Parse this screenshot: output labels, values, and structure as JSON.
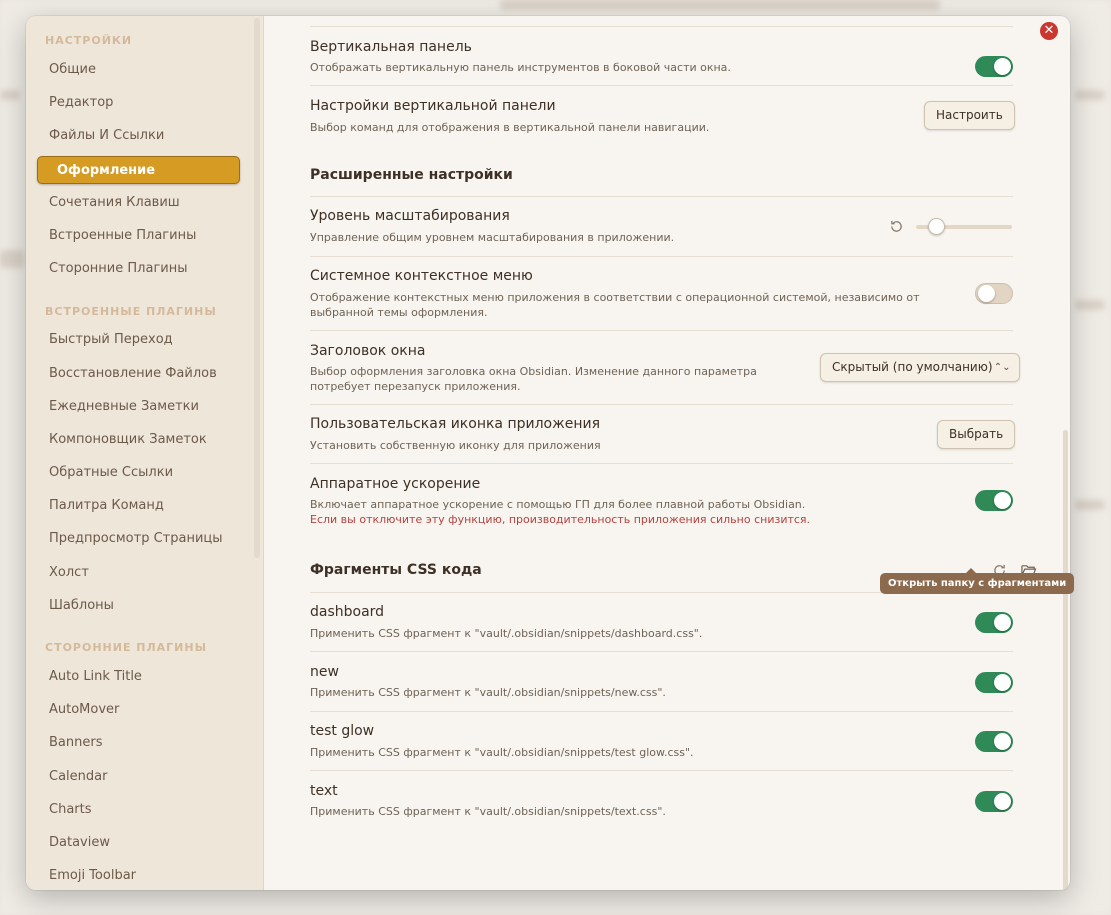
{
  "sidebar": {
    "groups": {
      "settings": "НАСТРОЙКИ",
      "core_plugins": "ВСТРОЕННЫЕ ПЛАГИНЫ",
      "community_plugins": "СТОРОННИЕ ПЛАГИНЫ"
    },
    "settings_items": [
      "Общие",
      "Редактор",
      "Файлы И Ссылки",
      "Оформление",
      "Сочетания Клавиш",
      "Встроенные Плагины",
      "Сторонние Плагины"
    ],
    "core_items": [
      "Быстрый Переход",
      "Восстановление Файлов",
      "Ежедневные Заметки",
      "Компоновщик Заметок",
      "Обратные Ссылки",
      "Палитра Команд",
      "Предпросмотр Страницы",
      "Холст",
      "Шаблоны"
    ],
    "community_items": [
      "Auto Link Title",
      "AutoMover",
      "Banners",
      "Calendar",
      "Charts",
      "Dataview",
      "Emoji Toolbar"
    ],
    "active_item": "Оформление"
  },
  "rows": {
    "vertical_panel": {
      "title": "Вертикальная панель",
      "desc": "Отображать вертикальную панель инструментов в боковой части окна.",
      "toggle": "on"
    },
    "vertical_panel_settings": {
      "title": "Настройки вертикальной панели",
      "desc": "Выбор команд для отображения в вертикальной панели навигации.",
      "button": "Настроить"
    },
    "advanced_heading": "Расширенные настройки",
    "zoom": {
      "title": "Уровень масштабирования",
      "desc": "Управление общим уровнем масштабирования в приложении.",
      "slider_value": 0.15
    },
    "context_menu": {
      "title": "Системное контекстное меню",
      "desc1": "Отображение контекстных меню приложения в соответствии с операционной системой, независимо от",
      "desc2": "выбранной темы оформления.",
      "toggle": "off"
    },
    "window_frame": {
      "title": "Заголовок окна",
      "desc1": "Выбор оформления заголовка окна Obsidian. Изменение данного параметра",
      "desc2": "потребует перезапуск приложения.",
      "select": "Скрытый (по умолчанию)"
    },
    "app_icon": {
      "title": "Пользовательская иконка приложения",
      "desc": "Установить собственную иконку для приложения",
      "button": "Выбрать"
    },
    "hw_accel": {
      "title": "Аппаратное ускорение",
      "desc": "Включает аппаратное ускорение с помощью ГП для более плавной работы Obsidian.",
      "warning": "Если вы отключите эту функцию, производительность приложения сильно снизится.",
      "toggle": "on"
    }
  },
  "snippets": {
    "heading": "Фрагменты CSS кода",
    "tooltip": "Открыть папку с фрагментами",
    "items": [
      {
        "name": "dashboard",
        "desc": "Применить CSS фрагмент к \"vault/.obsidian/snippets/dashboard.css\".",
        "toggle": "on"
      },
      {
        "name": "new",
        "desc": "Применить CSS фрагмент к \"vault/.obsidian/snippets/new.css\".",
        "toggle": "on"
      },
      {
        "name": "test glow",
        "desc": "Применить CSS фрагмент к \"vault/.obsidian/snippets/test glow.css\".",
        "toggle": "on"
      },
      {
        "name": "text",
        "desc": "Применить CSS фрагмент к \"vault/.obsidian/snippets/text.css\".",
        "toggle": "on"
      }
    ]
  },
  "icons": {
    "close": "close-icon",
    "reset": "reset-icon",
    "reload": "reload-icon",
    "folder": "folder-open-icon"
  },
  "colors": {
    "accent": "#d59b22",
    "toggle_on": "#2f8a58",
    "warning": "#b3423e",
    "close": "#c9382f"
  }
}
